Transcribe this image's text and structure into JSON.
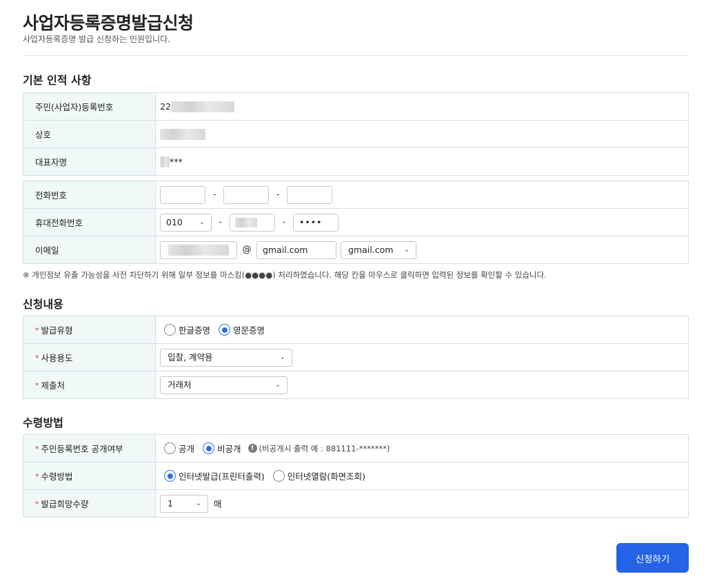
{
  "header": {
    "title": "사업자등록증명발급신청",
    "subtitle": "사업자등록증명 발급 신청하는 민원입니다."
  },
  "basic_info": {
    "section_title": "기본 인적 사항",
    "rrn_label": "주민(사업자)등록번호",
    "rrn_value": "22",
    "company_label": "상호",
    "rep_label": "대표자명",
    "rep_value": "***"
  },
  "contact": {
    "phone_label": "전화번호",
    "mobile_label": "휴대전화번호",
    "mobile_prefix": "010",
    "mobile_last": "••••",
    "email_label": "이메일",
    "at_sign": "@",
    "email_domain": "gmail.com",
    "email_domain_select": "gmail.com",
    "dash": "-"
  },
  "notice": "※ 개인정보 유출 가능성을 사전 차단하기 위해 일부 정보를 마스킹(●●●●) 처리하였습니다. 해당 칸을 마우스로 클릭하면 입력된 정보를 확인할 수 있습니다.",
  "application": {
    "section_title": "신청내용",
    "type_label": "발급유형",
    "type_korean": "한글증명",
    "type_english": "영문증명",
    "purpose_label": "사용용도",
    "purpose_value": "입찰, 계약용",
    "submit_to_label": "제출처",
    "submit_to_value": "거래처"
  },
  "receipt": {
    "section_title": "수령방법",
    "disclose_label": "주민등록번호 공개여부",
    "disclose_public": "공개",
    "disclose_private": "비공개",
    "disclose_hint": "(비공개시 출력 예 : 881111-*******)",
    "method_label": "수령방법",
    "method_internet_issue": "인터넷발급(프린터출력)",
    "method_internet_view": "인터넷열람(화면조회)",
    "quantity_label": "발급희망수량",
    "quantity_value": "1",
    "quantity_unit": "매"
  },
  "required_mark": "*",
  "submit_label": "신청하기"
}
